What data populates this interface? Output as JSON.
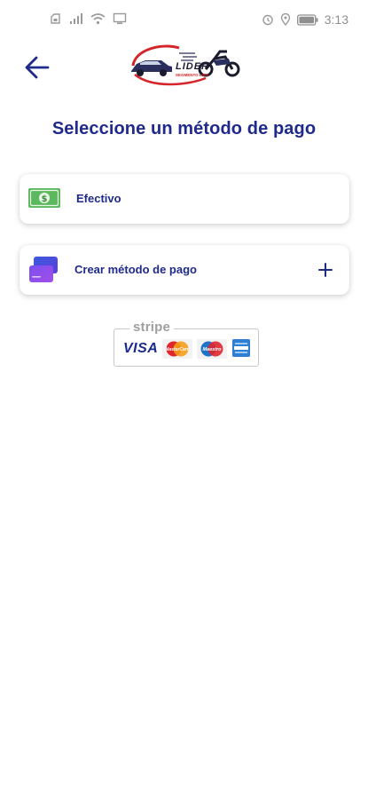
{
  "status_bar": {
    "time": "3:13",
    "left_icons": [
      "sim-icon",
      "signal-icon",
      "wifi-icon",
      "cast-icon"
    ],
    "right_icons": [
      "alarm-icon",
      "location-icon",
      "battery-icon"
    ]
  },
  "header": {
    "back_icon": "arrow-left-icon",
    "logo_text": "LIDER",
    "logo_subtext": "SEGMENTO LIMA"
  },
  "page": {
    "title": "Seleccione un método de pago"
  },
  "payment_methods": [
    {
      "label": "Efectivo",
      "icon": "cash-icon"
    },
    {
      "label": "Crear método de pago",
      "icon": "cards-icon",
      "action_icon": "plus-icon"
    }
  ],
  "stripe_badge": {
    "word": "stripe",
    "visa": "VISA",
    "mastercard": "MasterCard",
    "maestro": "Maestro",
    "brands": [
      "visa-logo",
      "mastercard-logo",
      "maestro-logo",
      "amex-logo"
    ]
  },
  "colors": {
    "primary": "#1f2a8c",
    "accent_purple": "#6a3fe0",
    "cash_green": "#5cb85c",
    "logo_red": "#d6252a"
  }
}
